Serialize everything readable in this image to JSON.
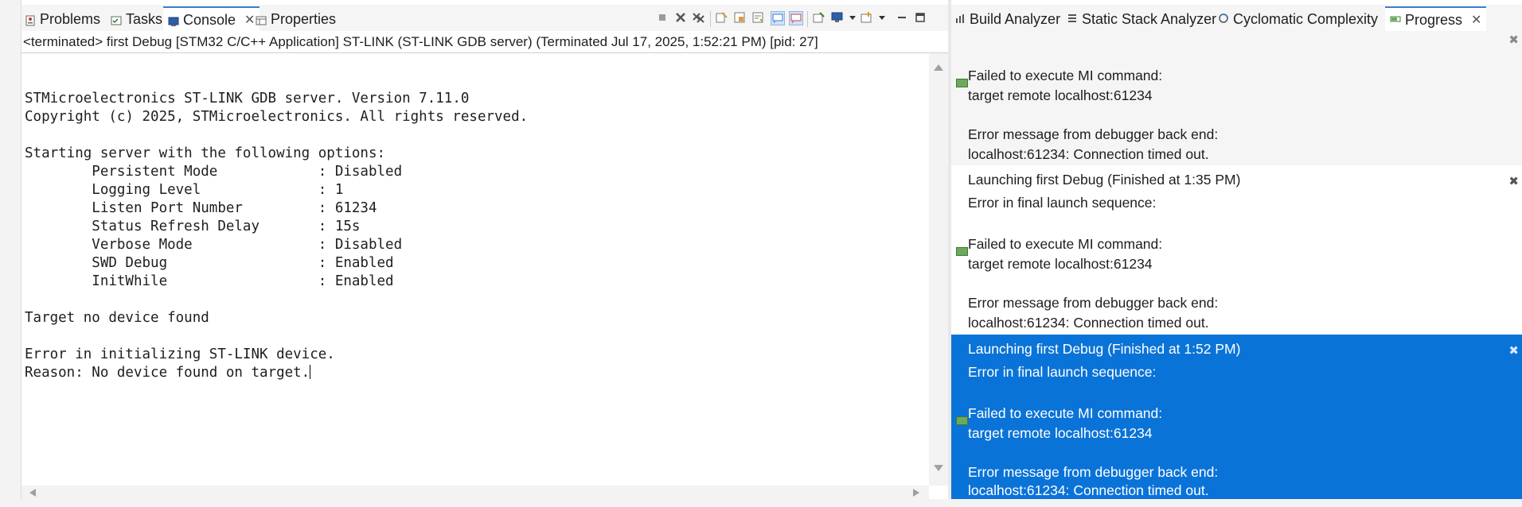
{
  "left_tabs": [
    {
      "label": "Problems",
      "icon": "problems-icon"
    },
    {
      "label": "Tasks",
      "icon": "tasks-icon"
    },
    {
      "label": "Console",
      "icon": "console-icon",
      "active": true,
      "close": "✕"
    },
    {
      "label": "Properties",
      "icon": "properties-icon"
    }
  ],
  "console_toolbar": [
    "terminate-icon",
    "remove-launch-icon",
    "remove-all-icon",
    "clear-console-icon",
    "scroll-lock-icon",
    "word-wrap-icon",
    "show-on-stdout-icon",
    "show-on-stderr-icon",
    "pin-console-icon",
    "display-selected-console-icon",
    "dropdown-icon",
    "open-console-icon",
    "dropdown-icon",
    "minimize-icon",
    "maximize-icon"
  ],
  "status_line": "<terminated> first Debug [STM32 C/C++ Application] ST-LINK (ST-LINK GDB server) (Terminated Jul 17, 2025, 1:52:21 PM) [pid: 27]",
  "console_lines": [
    "",
    "",
    "STMicroelectronics ST-LINK GDB server. Version 7.11.0",
    "Copyright (c) 2025, STMicroelectronics. All rights reserved.",
    "",
    "Starting server with the following options:",
    "        Persistent Mode            : Disabled",
    "        Logging Level              : 1",
    "        Listen Port Number         : 61234",
    "        Status Refresh Delay       : 15s",
    "        Verbose Mode               : Disabled",
    "        SWD Debug                  : Enabled",
    "        InitWhile                  : Enabled",
    "",
    "Target no device found",
    "",
    "Error in initializing ST-LINK device.",
    "Reason: No device found on target."
  ],
  "right_tabs": [
    {
      "label": "Build Analyzer",
      "icon": "build-analyzer-icon"
    },
    {
      "label": "Static Stack Analyzer",
      "icon": "static-stack-icon"
    },
    {
      "label": "Cyclomatic Complexity",
      "icon": "cyclomatic-icon"
    },
    {
      "label": "Progress",
      "icon": "progress-icon",
      "active": true,
      "close": "✕"
    }
  ],
  "progress": {
    "first_entry": {
      "mi_failed": "Failed to execute MI command:",
      "mi_cmd": "target remote localhost:61234",
      "err_title": "Error message from debugger back end:",
      "err_msg": "localhost:61234: Connection timed out."
    },
    "entries": [
      {
        "title": "Launching first Debug (Finished at 1:35 PM)",
        "subtitle": "Error in final launch sequence:",
        "mi_failed": "Failed to execute MI command:",
        "mi_cmd": "target remote localhost:61234",
        "err_title": "Error message from debugger back end:",
        "err_msg": "localhost:61234: Connection timed out.",
        "remove": "✖"
      },
      {
        "title": "Launching first Debug (Finished at 1:52 PM)",
        "subtitle": "Error in final launch sequence:",
        "mi_failed": "Failed to execute MI command:",
        "mi_cmd": "target remote localhost:61234",
        "err_title": "Error message from debugger back end:",
        "err_msg": "localhost:61234: Connection timed out.",
        "remove": "✖"
      }
    ]
  },
  "colors": {
    "selection": "#0a73d8",
    "active_tab_border": "#3c7dd2"
  }
}
